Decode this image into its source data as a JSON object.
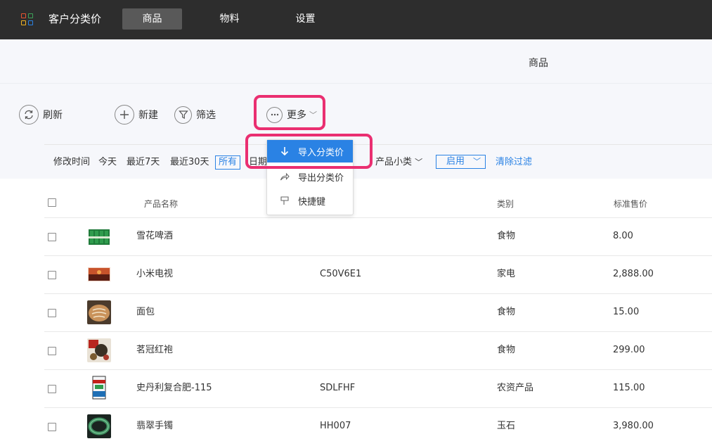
{
  "app": {
    "title": "客户分类价",
    "nav": [
      {
        "label": "商品",
        "active": true
      },
      {
        "label": "物料",
        "active": false
      },
      {
        "label": "设置",
        "active": false
      }
    ]
  },
  "page": {
    "title": "商品"
  },
  "toolbar": {
    "refresh_label": "刷新",
    "new_label": "新建",
    "filter_label": "筛选",
    "more_label": "更多"
  },
  "more_menu": {
    "items": [
      {
        "label": "导入分类价",
        "icon": "arrow-down-icon",
        "active": true
      },
      {
        "label": "导出分类价",
        "icon": "share-arrow-icon",
        "active": false
      },
      {
        "label": "快捷键",
        "icon": "pin-icon",
        "active": false
      }
    ]
  },
  "filters": {
    "modified_label": "修改时间",
    "today": "今天",
    "last7": "最近7天",
    "last30": "最近30天",
    "all": "所有",
    "date_partial": "日期",
    "sub_category": "产品小类",
    "status": "启用",
    "clear": "清除过滤"
  },
  "table": {
    "headers": {
      "name": "产品名称",
      "category": "类别",
      "price": "标准售价"
    },
    "rows": [
      {
        "name": "雪花啤酒",
        "code": "",
        "category": "食物",
        "price": "8.00",
        "thumb": "beer-cans"
      },
      {
        "name": "小米电视",
        "code": "C50V6E1",
        "category": "家电",
        "price": "2,888.00",
        "thumb": "tv"
      },
      {
        "name": "面包",
        "code": "",
        "category": "食物",
        "price": "15.00",
        "thumb": "bread"
      },
      {
        "name": "茗冠红袍",
        "code": "",
        "category": "食物",
        "price": "299.00",
        "thumb": "tea"
      },
      {
        "name": "史丹利复合肥-115",
        "code": "SDLFHF",
        "category": "农资产品",
        "price": "115.00",
        "thumb": "fertilizer-bag"
      },
      {
        "name": "翡翠手镯",
        "code": "HH007",
        "category": "玉石",
        "price": "3,980.00",
        "thumb": "jade-bracelet"
      }
    ]
  },
  "colors": {
    "topbar": "#2d2d2d",
    "accent": "#2a82e4",
    "highlight": "#ea2f71",
    "band": "#f6f7fb"
  }
}
